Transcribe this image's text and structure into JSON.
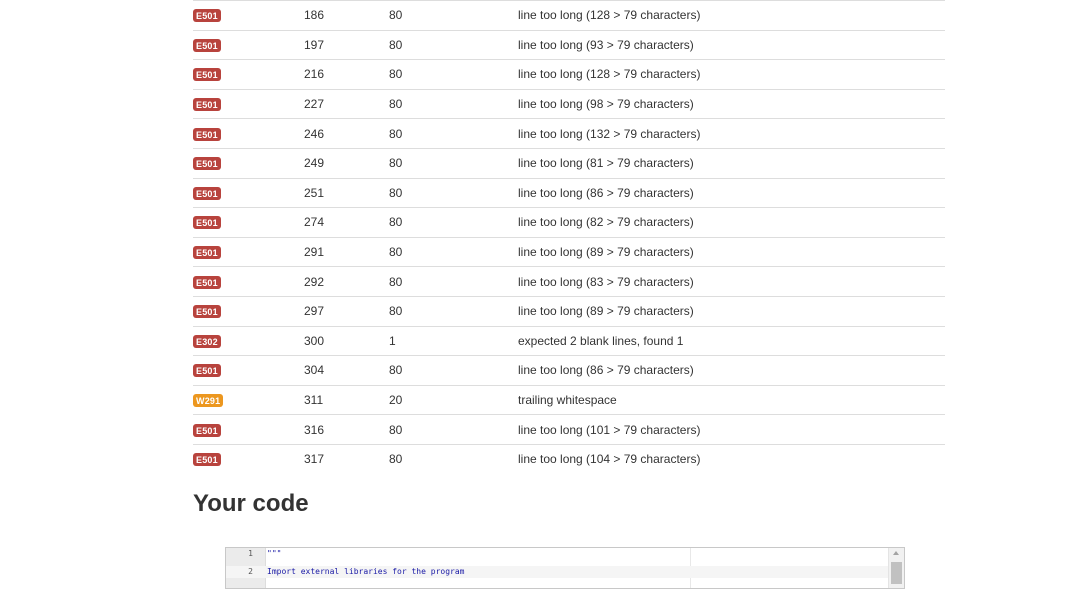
{
  "results": [
    {
      "code": "E501",
      "level": "error",
      "line": "186",
      "column": "80",
      "message": "line too long (128 > 79 characters)"
    },
    {
      "code": "E501",
      "level": "error",
      "line": "197",
      "column": "80",
      "message": "line too long (93 > 79 characters)"
    },
    {
      "code": "E501",
      "level": "error",
      "line": "216",
      "column": "80",
      "message": "line too long (128 > 79 characters)"
    },
    {
      "code": "E501",
      "level": "error",
      "line": "227",
      "column": "80",
      "message": "line too long (98 > 79 characters)"
    },
    {
      "code": "E501",
      "level": "error",
      "line": "246",
      "column": "80",
      "message": "line too long (132 > 79 characters)"
    },
    {
      "code": "E501",
      "level": "error",
      "line": "249",
      "column": "80",
      "message": "line too long (81 > 79 characters)"
    },
    {
      "code": "E501",
      "level": "error",
      "line": "251",
      "column": "80",
      "message": "line too long (86 > 79 characters)"
    },
    {
      "code": "E501",
      "level": "error",
      "line": "274",
      "column": "80",
      "message": "line too long (82 > 79 characters)"
    },
    {
      "code": "E501",
      "level": "error",
      "line": "291",
      "column": "80",
      "message": "line too long (89 > 79 characters)"
    },
    {
      "code": "E501",
      "level": "error",
      "line": "292",
      "column": "80",
      "message": "line too long (83 > 79 characters)"
    },
    {
      "code": "E501",
      "level": "error",
      "line": "297",
      "column": "80",
      "message": "line too long (89 > 79 characters)"
    },
    {
      "code": "E302",
      "level": "error",
      "line": "300",
      "column": "1",
      "message": "expected 2 blank lines, found 1"
    },
    {
      "code": "E501",
      "level": "error",
      "line": "304",
      "column": "80",
      "message": "line too long (86 > 79 characters)"
    },
    {
      "code": "W291",
      "level": "warning",
      "line": "311",
      "column": "20",
      "message": "trailing whitespace"
    },
    {
      "code": "E501",
      "level": "error",
      "line": "316",
      "column": "80",
      "message": "line too long (101 > 79 characters)"
    },
    {
      "code": "E501",
      "level": "error",
      "line": "317",
      "column": "80",
      "message": "line too long (104 > 79 characters)"
    }
  ],
  "code_section": {
    "title": "Your code",
    "lines": [
      {
        "number": "1",
        "text": "\"\"\""
      },
      {
        "number": "2",
        "text": "Import external libraries for the program"
      }
    ]
  },
  "colors": {
    "error_badge": "#b8433d",
    "warning_badge": "#ec971f"
  },
  "icons": {
    "scroll_up": "triangle-up"
  }
}
